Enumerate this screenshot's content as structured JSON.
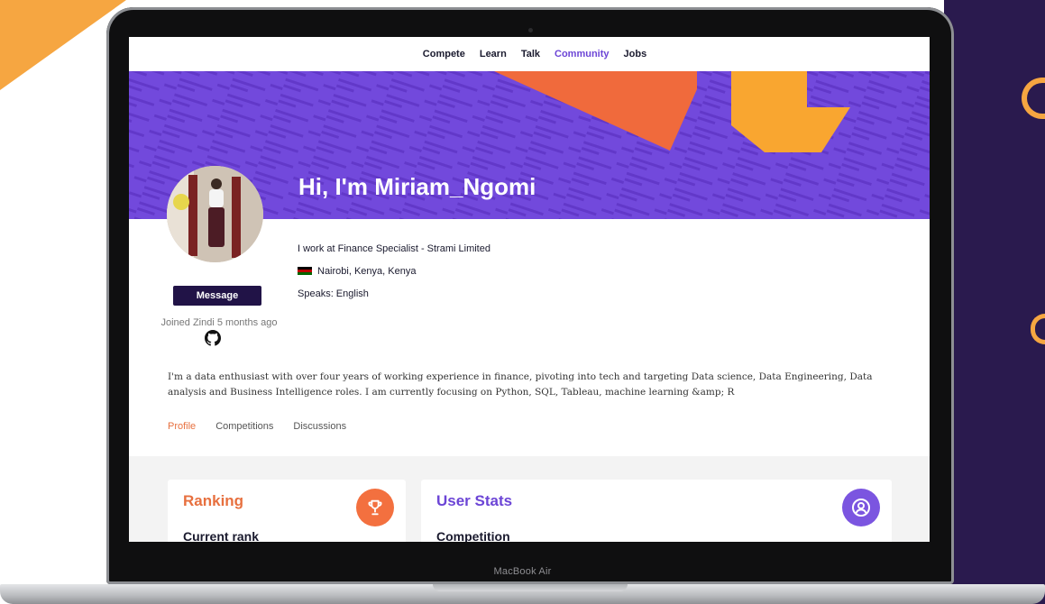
{
  "nav": {
    "items": [
      {
        "label": "Compete"
      },
      {
        "label": "Learn"
      },
      {
        "label": "Talk"
      },
      {
        "label": "Community"
      },
      {
        "label": "Jobs"
      }
    ],
    "active": "Community"
  },
  "profile": {
    "greeting": "Hi, I'm Miriam_Ngomi",
    "work": "I work at Finance Specialist - Strami Limited",
    "location": "Nairobi, Kenya, Kenya",
    "speaks": "Speaks: English",
    "message_label": "Message",
    "joined": "Joined Zindi 5 months ago",
    "bio": "I'm a data enthusiast with over four years of working experience in finance, pivoting into tech and targeting Data science, Data Engineering, Data analysis and Business Intelligence roles. I am currently focusing on Python, SQL, Tableau, machine learning &amp; R"
  },
  "tabs": [
    {
      "label": "Profile"
    },
    {
      "label": "Competitions"
    },
    {
      "label": "Discussions"
    }
  ],
  "cards": {
    "ranking": {
      "title": "Ranking",
      "subtitle": "Current rank",
      "icon": "trophy-icon"
    },
    "stats": {
      "title": "User Stats",
      "subtitle": "Competition",
      "icon": "user-circle-icon"
    }
  },
  "device": {
    "brand": "MacBook Air"
  },
  "colors": {
    "brand_purple": "#7249dc",
    "accent_orange": "#e7703f",
    "button_dark": "#211347",
    "nav_active": "#6c45d6"
  }
}
